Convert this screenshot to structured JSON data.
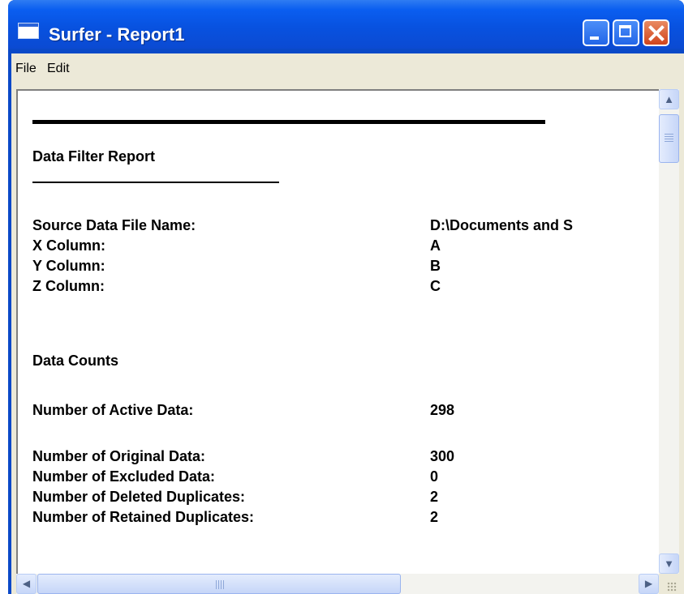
{
  "window": {
    "title": "Surfer - Report1"
  },
  "menu": {
    "file": "File",
    "edit": "Edit"
  },
  "report": {
    "title": "Data Filter Report",
    "source_rows": [
      {
        "label": "Source Data File Name:",
        "value": "D:\\Documents and S"
      },
      {
        "label": "X Column:",
        "value": "A"
      },
      {
        "label": "Y Column:",
        "value": "B"
      },
      {
        "label": "Z Column:",
        "value": "C"
      }
    ],
    "counts_heading": "Data Counts",
    "active": {
      "label": "Number of Active Data:",
      "value": "298"
    },
    "count_rows": [
      {
        "label": "Number of Original Data:",
        "value": "300"
      },
      {
        "label": "Number of Excluded Data:",
        "value": "0"
      },
      {
        "label": "Number of Deleted Duplicates:",
        "value": "2"
      },
      {
        "label": "Number of Retained Duplicates:",
        "value": "2"
      }
    ]
  },
  "scrollbars": {
    "up_icon": "▲",
    "down_icon": "▼",
    "left_icon": "◀",
    "right_icon": "▶"
  },
  "icons": {
    "window_icon": "app-window-icon",
    "minimize": "minimize-icon",
    "maximize": "maximize-icon",
    "close": "close-icon"
  },
  "colors": {
    "titlebar": "#0a5ef0",
    "close_button": "#d0441c",
    "chrome": "#ece9d8"
  }
}
